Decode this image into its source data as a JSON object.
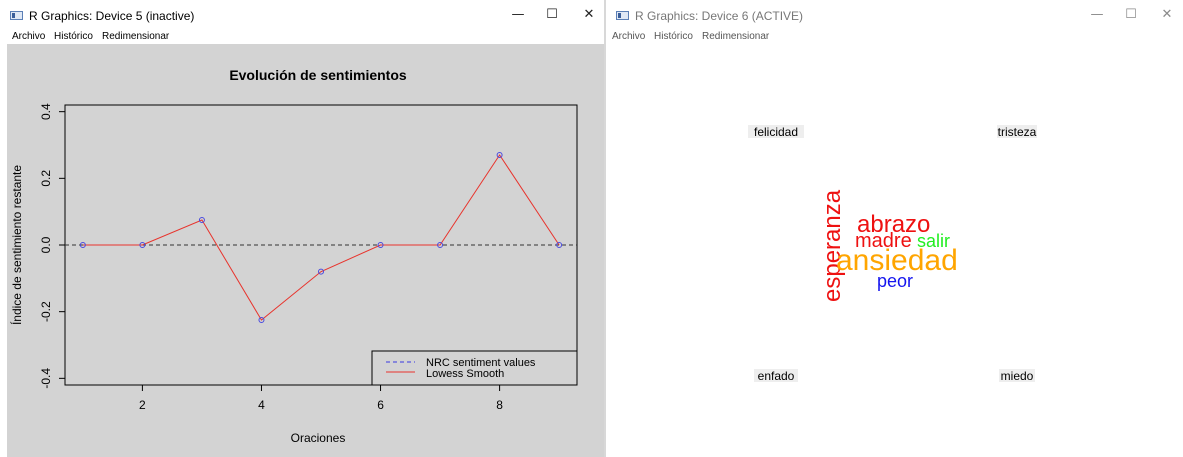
{
  "windows": [
    {
      "title": "R Graphics: Device 5 (inactive)",
      "menu": [
        "Archivo",
        "Histórico",
        "Redimensionar"
      ],
      "controls": {
        "minimize": "—",
        "maximize": "☐",
        "close": "✕"
      }
    },
    {
      "title": "R Graphics: Device 6 (ACTIVE)",
      "menu": [
        "Archivo",
        "Histórico",
        "Redimensionar"
      ],
      "controls": {
        "minimize": "—",
        "maximize": "☐",
        "close": "✕"
      }
    }
  ],
  "chart_data": {
    "type": "line",
    "title": "Evolución de sentimientos",
    "xlabel": "Oraciones",
    "ylabel": "Índice de sentimiento restante",
    "xlim": [
      0.7,
      9.3
    ],
    "ylim": [
      -0.42,
      0.42
    ],
    "xticks": [
      2,
      4,
      6,
      8
    ],
    "yticks": [
      -0.4,
      -0.2,
      0.0,
      0.2,
      0.4
    ],
    "ytick_labels": [
      "-0.4",
      "-0.2",
      "0.0",
      "0.2",
      "0.4"
    ],
    "grid": false,
    "reference_line": 0.0,
    "legend_position": "bottom-right",
    "colors": {
      "points": "#4a4adf",
      "line": "#e8332c",
      "reference": "#333333",
      "legend_dashed": "#3a3ae0"
    },
    "series": [
      {
        "name": "NRC sentiment values",
        "x": [
          1,
          2,
          3,
          4,
          5,
          6,
          7,
          8,
          9
        ],
        "values": [
          0.0,
          0.0,
          0.075,
          -0.225,
          -0.08,
          0.0,
          0.0,
          0.27,
          0.0
        ]
      },
      {
        "name": "Lowess Smooth",
        "x": [
          1,
          2,
          3,
          4,
          5,
          6,
          7,
          8,
          9
        ],
        "values": [
          0.0,
          0.0,
          0.075,
          -0.225,
          -0.08,
          0.0,
          0.0,
          0.27,
          0.0
        ]
      }
    ]
  },
  "wordcloud": {
    "categories": [
      "felicidad",
      "tristeza",
      "enfado",
      "miedo"
    ],
    "words": [
      {
        "text": "esperanza",
        "color": "#ee1111",
        "vertical": true
      },
      {
        "text": "abrazo",
        "color": "#ee1111"
      },
      {
        "text": "madre",
        "color": "#ee1111"
      },
      {
        "text": "salir",
        "color": "#22ee22"
      },
      {
        "text": "ansiedad",
        "color": "#ffa500"
      },
      {
        "text": "peor",
        "color": "#1515ee"
      }
    ]
  }
}
